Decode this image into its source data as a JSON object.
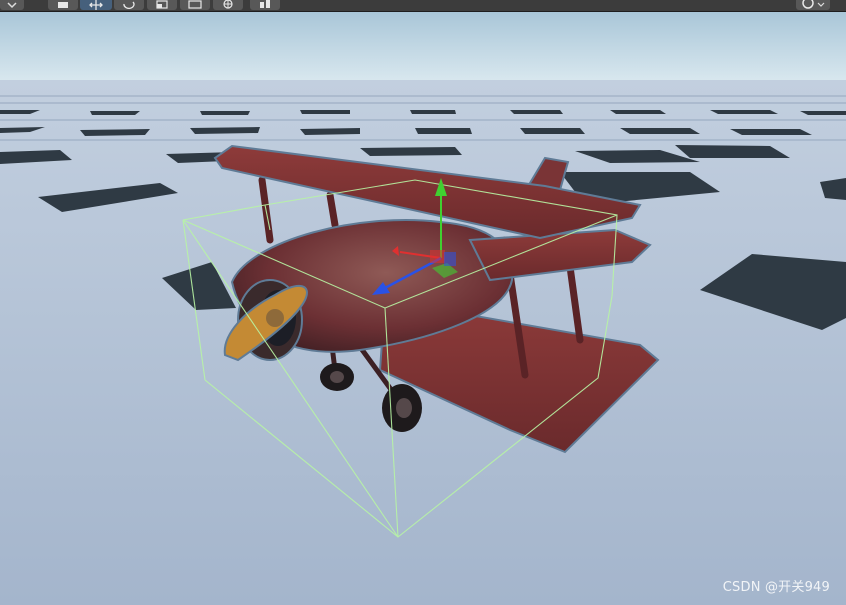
{
  "toolbar": {
    "tools": [
      {
        "name": "view-tool",
        "icon": "hand-icon"
      },
      {
        "name": "move-tool",
        "icon": "move-arrows-icon",
        "active": true
      },
      {
        "name": "rotate-tool",
        "icon": "rotate-icon"
      },
      {
        "name": "scale-tool",
        "icon": "scale-icon"
      },
      {
        "name": "rect-tool",
        "icon": "rect-transform-icon"
      },
      {
        "name": "transform-tool",
        "icon": "transform-combined-icon"
      },
      {
        "name": "custom-tool",
        "icon": "custom-editor-tool-icon"
      }
    ],
    "right_control_icon": "gizmo-toggle-icon"
  },
  "viewport": {
    "sky_color": "#c6dbe9",
    "ground_color": "#b1c1d7",
    "grid_tile_color": "#2f3a44",
    "selected_object": "biplane",
    "bounds_color": "#b8f5a4",
    "gizmo": {
      "x_axis": "#e03030",
      "y_axis": "#40d030",
      "z_axis": "#2a52e6"
    }
  },
  "watermark": "CSDN @开关949"
}
